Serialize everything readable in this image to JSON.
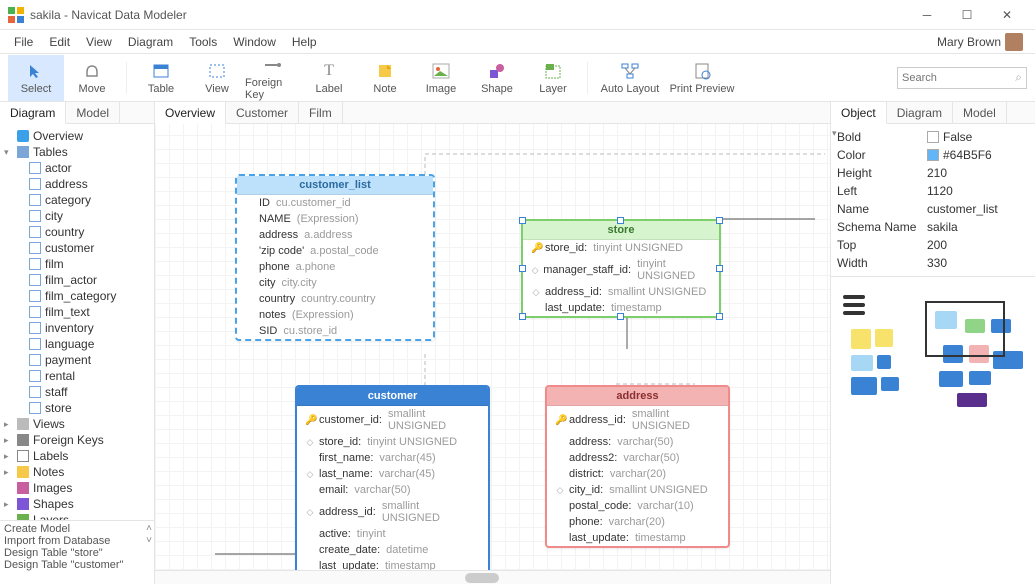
{
  "window": {
    "title": "sakila - Navicat Data Modeler",
    "user": "Mary Brown"
  },
  "menu": [
    "File",
    "Edit",
    "View",
    "Diagram",
    "Tools",
    "Window",
    "Help"
  ],
  "toolbar": [
    {
      "id": "select",
      "label": "Select",
      "selected": true
    },
    {
      "id": "move",
      "label": "Move"
    },
    {
      "sep": true
    },
    {
      "id": "table",
      "label": "Table"
    },
    {
      "id": "view",
      "label": "View"
    },
    {
      "id": "foreign-key",
      "label": "Foreign Key"
    },
    {
      "id": "label",
      "label": "Label"
    },
    {
      "id": "note",
      "label": "Note"
    },
    {
      "id": "image",
      "label": "Image"
    },
    {
      "id": "shape",
      "label": "Shape"
    },
    {
      "id": "layer",
      "label": "Layer"
    },
    {
      "sep": true
    },
    {
      "id": "auto-layout",
      "label": "Auto Layout"
    },
    {
      "id": "print-preview",
      "label": "Print Preview"
    }
  ],
  "search": {
    "placeholder": "Search"
  },
  "left_tabs": [
    "Diagram",
    "Model"
  ],
  "canvas_tabs": [
    "Overview",
    "Customer",
    "Film"
  ],
  "right_tabs": [
    "Object",
    "Diagram",
    "Model"
  ],
  "tree": [
    {
      "lvl": 0,
      "ico": "overview",
      "label": "Overview"
    },
    {
      "lvl": 0,
      "ico": "tables",
      "label": "Tables",
      "exp": true,
      "expander": "▾"
    },
    {
      "lvl": 1,
      "ico": "table",
      "label": "actor"
    },
    {
      "lvl": 1,
      "ico": "table",
      "label": "address"
    },
    {
      "lvl": 1,
      "ico": "table",
      "label": "category"
    },
    {
      "lvl": 1,
      "ico": "table",
      "label": "city"
    },
    {
      "lvl": 1,
      "ico": "table",
      "label": "country"
    },
    {
      "lvl": 1,
      "ico": "table",
      "label": "customer"
    },
    {
      "lvl": 1,
      "ico": "table",
      "label": "film"
    },
    {
      "lvl": 1,
      "ico": "table",
      "label": "film_actor"
    },
    {
      "lvl": 1,
      "ico": "table",
      "label": "film_category"
    },
    {
      "lvl": 1,
      "ico": "table",
      "label": "film_text"
    },
    {
      "lvl": 1,
      "ico": "table",
      "label": "inventory"
    },
    {
      "lvl": 1,
      "ico": "table",
      "label": "language"
    },
    {
      "lvl": 1,
      "ico": "table",
      "label": "payment"
    },
    {
      "lvl": 1,
      "ico": "table",
      "label": "rental"
    },
    {
      "lvl": 1,
      "ico": "table",
      "label": "staff"
    },
    {
      "lvl": 1,
      "ico": "table",
      "label": "store"
    },
    {
      "lvl": 0,
      "ico": "views",
      "label": "Views",
      "expander": "▸"
    },
    {
      "lvl": 0,
      "ico": "fk",
      "label": "Foreign Keys",
      "expander": "▸"
    },
    {
      "lvl": 0,
      "ico": "labels",
      "label": "Labels",
      "expander": "▸"
    },
    {
      "lvl": 0,
      "ico": "notes",
      "label": "Notes",
      "expander": "▸"
    },
    {
      "lvl": 0,
      "ico": "images",
      "label": "Images"
    },
    {
      "lvl": 0,
      "ico": "shapes",
      "label": "Shapes",
      "expander": "▸"
    },
    {
      "lvl": 0,
      "ico": "layers",
      "label": "Layers"
    }
  ],
  "actions": [
    "Create Model",
    "Import from Database",
    "Design Table \"store\"",
    "Design Table \"customer\""
  ],
  "entities": {
    "customer_list": {
      "title": "customer_list",
      "rows": [
        {
          "name": "ID",
          "type": "cu.customer_id"
        },
        {
          "name": "NAME",
          "type": "(Expression)"
        },
        {
          "name": "address",
          "type": "a.address"
        },
        {
          "name": "'zip code'",
          "type": "a.postal_code"
        },
        {
          "name": "phone",
          "type": "a.phone"
        },
        {
          "name": "city",
          "type": "city.city"
        },
        {
          "name": "country",
          "type": "country.country"
        },
        {
          "name": "notes",
          "type": "(Expression)"
        },
        {
          "name": "SID",
          "type": "cu.store_id"
        }
      ]
    },
    "store": {
      "title": "store",
      "rows": [
        {
          "key": true,
          "name": "store_id:",
          "type": "tinyint UNSIGNED"
        },
        {
          "dia": true,
          "name": "manager_staff_id:",
          "type": "tinyint UNSIGNED"
        },
        {
          "dia": true,
          "name": "address_id:",
          "type": "smallint UNSIGNED"
        },
        {
          "name": "last_update:",
          "type": "timestamp"
        }
      ]
    },
    "customer": {
      "title": "customer",
      "rows": [
        {
          "key": true,
          "name": "customer_id:",
          "type": "smallint UNSIGNED"
        },
        {
          "dia": true,
          "name": "store_id:",
          "type": "tinyint UNSIGNED"
        },
        {
          "name": "first_name:",
          "type": "varchar(45)"
        },
        {
          "dia": true,
          "name": "last_name:",
          "type": "varchar(45)"
        },
        {
          "name": "email:",
          "type": "varchar(50)"
        },
        {
          "dia": true,
          "name": "address_id:",
          "type": "smallint UNSIGNED"
        },
        {
          "name": "active:",
          "type": "tinyint"
        },
        {
          "name": "create_date:",
          "type": "datetime"
        },
        {
          "name": "last_update:",
          "type": "timestamp"
        }
      ]
    },
    "address": {
      "title": "address",
      "rows": [
        {
          "key": true,
          "name": "address_id:",
          "type": "smallint UNSIGNED"
        },
        {
          "name": "address:",
          "type": "varchar(50)"
        },
        {
          "name": "address2:",
          "type": "varchar(50)"
        },
        {
          "name": "district:",
          "type": "varchar(20)"
        },
        {
          "dia": true,
          "name": "city_id:",
          "type": "smallint UNSIGNED"
        },
        {
          "name": "postal_code:",
          "type": "varchar(10)"
        },
        {
          "name": "phone:",
          "type": "varchar(20)"
        },
        {
          "name": "last_update:",
          "type": "timestamp"
        }
      ]
    }
  },
  "properties": [
    {
      "k": "Bold",
      "v": "False",
      "swatch": "white"
    },
    {
      "k": "Color",
      "v": "#64B5F6",
      "swatch": "color"
    },
    {
      "k": "Height",
      "v": "210"
    },
    {
      "k": "Left",
      "v": "1120"
    },
    {
      "k": "Name",
      "v": "customer_list"
    },
    {
      "k": "Schema Name",
      "v": "sakila"
    },
    {
      "k": "Top",
      "v": "200"
    },
    {
      "k": "Width",
      "v": "330"
    }
  ],
  "prop_expander": "▾"
}
